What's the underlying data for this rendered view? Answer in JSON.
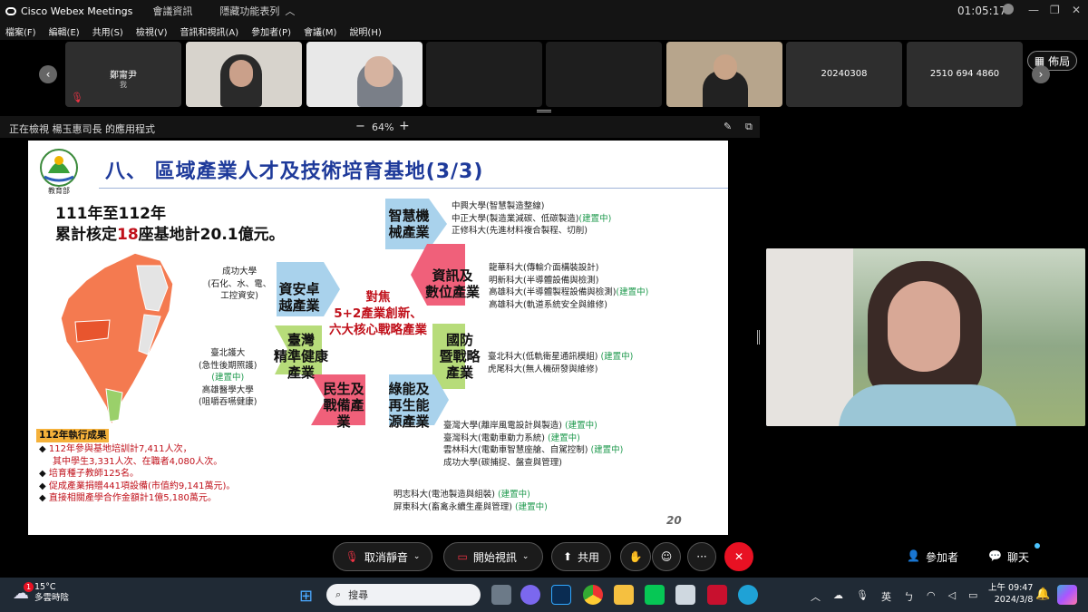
{
  "app": {
    "title": "Cisco Webex Meetings",
    "menu1": "會議資訊",
    "menu2": "隱藏功能表列",
    "time": "01:05:17"
  },
  "menubar": [
    "檔案(F)",
    "編輯(E)",
    "共用(S)",
    "檢視(V)",
    "音訊和視訊(A)",
    "參加者(P)",
    "會議(M)",
    "說明(H)"
  ],
  "participants": {
    "self": {
      "name": "鄭甯尹",
      "sub": "我"
    },
    "tile6": "20240308",
    "tile7": "2510 694 4860",
    "layout_label": "佈局"
  },
  "viewbar": {
    "label": "正在檢視 楊玉惠司長 的應用程式",
    "zoom": "64%",
    "minus": "−",
    "plus": "+"
  },
  "slide": {
    "title": "八、 區域產業人才及技術培育基地(3/3)",
    "logo_text": "教育部",
    "logo_arc": "MINISTRY OF EDUCATION",
    "summary_line1": "111年至112年",
    "summary_line2a": "累計核定",
    "summary_num": "18",
    "summary_line2b": "座基地計",
    "summary_amount": "20.1",
    "summary_line2c": "億元。",
    "center1": "對焦",
    "center2": "5+2產業創新、",
    "center3": "六大核心戰略產業",
    "hex": {
      "smart": "智慧機\n械產業",
      "it": "資訊及\n數位產業",
      "defense": "國防\n暨戰略\n產業",
      "green": "綠能及\n再生能\n源產業",
      "civil": "民生及\n戰備產\n業",
      "health": "臺灣\n精準健康\n產業",
      "security": "資安卓\n越產業"
    },
    "left_groups": {
      "g1": [
        "成功大學",
        "(石化、水、電、",
        "工控資安)"
      ],
      "g2": [
        "臺北護大",
        "(急性後期照護)",
        "(建置中)",
        "高雄醫學大學",
        "(咀嚼吞嚥健康)"
      ]
    },
    "right_groups": {
      "smart": [
        "中興大學(智慧製造整線)",
        "中正大學(製造業減碳、低碳製造)",
        "(建置中)",
        "正修科大(先進材料複合製程、切削)"
      ],
      "it": [
        "龍華科大(傳輸介面構裝設計)",
        "明新科大(半導體設備與檢測)",
        "高雄科大(半導體製程設備與檢測)",
        "(建置中)",
        "高雄科大(軌道系統安全與維修)"
      ],
      "defense": [
        "臺北科大(低軌衛星通訊模組)",
        "(建置中)",
        "虎尾科大(無人機研發與維修)"
      ],
      "green": [
        "臺灣大學(離岸風電設計與製造)",
        "(建置中)",
        "臺灣科大(電動車動力系統)",
        "(建置中)",
        "雲林科大(電動車智慧座艙、自駕控制)",
        "(建置中)",
        "成功大學(碳捕捉、盤查與管理)"
      ],
      "bottom": [
        "明志科大(電池製造與組裝)",
        "(建置中)",
        "屏東科大(畜禽永續生產與管理)",
        "(建置中)"
      ]
    },
    "results_title": "112年執行成果",
    "results": [
      "112年參與基地培訓計7,411人次，",
      "其中學生3,331人次、在職者4,080人次。",
      "培育種子教師125名。",
      "促成產業捐贈441項設備(市值約9,141萬元)。",
      "直接相關產學合作金額計1億5,180萬元。"
    ],
    "page_no": "20"
  },
  "controls": {
    "mute": "取消靜音",
    "video": "開始視訊",
    "share": "共用",
    "participants": "參加者",
    "chat": "聊天"
  },
  "taskbar": {
    "temp": "15°C",
    "weather": "多雲時陰",
    "badge": "1",
    "search": "搜尋",
    "ime": "英",
    "time": "上午 09:47",
    "date": "2024/3/8"
  },
  "colors": {
    "accent_red": "#e81123",
    "slide_title": "#1e3a9a",
    "hex_blue": "#a9d2ec",
    "hex_red": "#f0607a",
    "hex_green": "#b7dc7a"
  }
}
